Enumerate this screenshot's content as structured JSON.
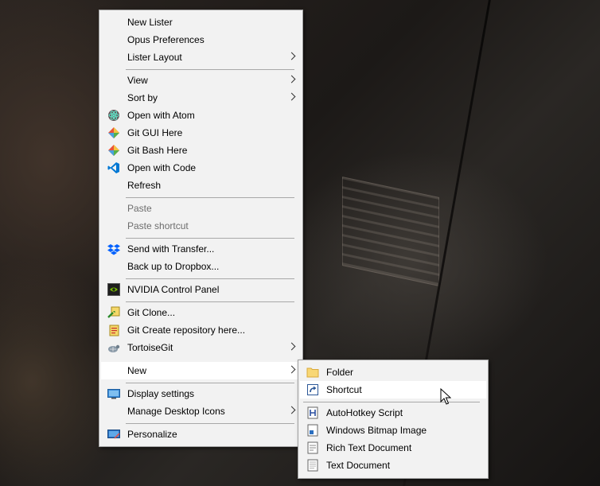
{
  "context_menu": {
    "items": [
      {
        "label": "New Lister"
      },
      {
        "label": "Opus Preferences"
      },
      {
        "label": "Lister Layout"
      },
      {
        "label": "View"
      },
      {
        "label": "Sort by"
      },
      {
        "label": "Open with Atom",
        "icon": "atom-icon"
      },
      {
        "label": "Git GUI Here",
        "icon": "git-icon"
      },
      {
        "label": "Git Bash Here",
        "icon": "git-icon"
      },
      {
        "label": "Open with Code",
        "icon": "vscode-icon"
      },
      {
        "label": "Refresh"
      },
      {
        "label": "Paste",
        "disabled": true
      },
      {
        "label": "Paste shortcut",
        "disabled": true
      },
      {
        "label": "Send with Transfer...",
        "icon": "dropbox-icon"
      },
      {
        "label": "Back up to Dropbox..."
      },
      {
        "label": "NVIDIA Control Panel",
        "icon": "nvidia-icon"
      },
      {
        "label": "Git Clone...",
        "icon": "tortoisegit-clone-icon"
      },
      {
        "label": "Git Create repository here...",
        "icon": "tortoisegit-create-icon"
      },
      {
        "label": "TortoiseGit",
        "icon": "tortoisegit-icon"
      },
      {
        "label": "New",
        "highlighted": true
      },
      {
        "label": "Display settings",
        "icon": "display-icon"
      },
      {
        "label": "Manage Desktop Icons"
      },
      {
        "label": "Personalize",
        "icon": "personalize-icon"
      }
    ]
  },
  "new_submenu": {
    "items": [
      {
        "label": "Folder",
        "icon": "folder-icon"
      },
      {
        "label": "Shortcut",
        "icon": "shortcut-icon",
        "highlighted": true
      },
      {
        "label": "AutoHotkey Script",
        "icon": "autohotkey-icon"
      },
      {
        "label": "Windows Bitmap Image",
        "icon": "bitmap-icon"
      },
      {
        "label": "Rich Text Document",
        "icon": "rich-text-icon"
      },
      {
        "label": "Text Document",
        "icon": "text-document-icon"
      }
    ]
  },
  "colors": {
    "menu_bg": "#f2f2f2",
    "highlight_bg": "#ffffff",
    "disabled_text": "#6d6d6d"
  }
}
